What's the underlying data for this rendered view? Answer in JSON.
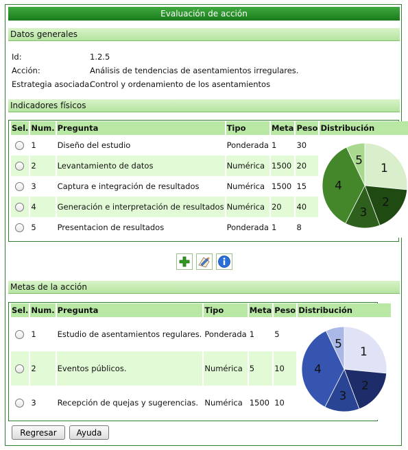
{
  "window": {
    "title": "Evaluación de acción"
  },
  "datos_generales": {
    "header": "Datos generales",
    "fields": [
      {
        "label": "Id:",
        "value": "1.2.5"
      },
      {
        "label": "Acción:",
        "value": "Análisis de tendencias de asentamientos irregulares."
      },
      {
        "label": "Estrategia asociada:",
        "value": "Control y ordenamiento de los asentamientos"
      }
    ]
  },
  "indicadores": {
    "header": "Indicadores físicos",
    "columns": [
      "Sel.",
      "Num.",
      "Pregunta",
      "Tipo",
      "Meta",
      "Peso",
      "Distribución"
    ],
    "rows": [
      {
        "num": "1",
        "pregunta": "Diseño del estudio",
        "tipo": "Ponderada",
        "meta": "1",
        "peso": "30"
      },
      {
        "num": "2",
        "pregunta": "Levantamiento de datos",
        "tipo": "Numérica",
        "meta": "1500",
        "peso": "20"
      },
      {
        "num": "3",
        "pregunta": "Captura e integración de resultados",
        "tipo": "Numérica",
        "meta": "1500",
        "peso": "15"
      },
      {
        "num": "4",
        "pregunta": "Generación e interpretación de resultados",
        "tipo": "Numérica",
        "meta": "20",
        "peso": "40"
      },
      {
        "num": "5",
        "pregunta": "Presentacion de resultados",
        "tipo": "Ponderada",
        "meta": "1",
        "peso": "8"
      }
    ],
    "pie": {
      "labels": [
        "1",
        "2",
        "3",
        "4",
        "5"
      ],
      "values": [
        30,
        20,
        15,
        40,
        8
      ],
      "colors": [
        "#d9efcc",
        "#1f4a12",
        "#2f5f1c",
        "#44862a",
        "#a9d98e"
      ]
    }
  },
  "toolbar": {
    "add_icon": "plus-icon",
    "edit_icon": "edit-icon",
    "info_icon": "info-icon",
    "colors": {
      "add": "#2e9a1e",
      "info": "#2a6fd8"
    }
  },
  "metas": {
    "header": "Metas de la acción",
    "columns": [
      "Sel.",
      "Num.",
      "Pregunta",
      "Tipo",
      "Meta",
      "Peso",
      "Distribución"
    ],
    "rows": [
      {
        "num": "1",
        "pregunta": "Estudio de asentamientos regulares.",
        "tipo": "Ponderada",
        "meta": "1",
        "peso": "5"
      },
      {
        "num": "2",
        "pregunta": "Eventos públicos.",
        "tipo": "Numérica",
        "meta": "5",
        "peso": "10"
      },
      {
        "num": "3",
        "pregunta": "Recepción de quejas y sugerencias.",
        "tipo": "Numérica",
        "meta": "1500",
        "peso": "10"
      }
    ],
    "pie": {
      "labels": [
        "1",
        "2",
        "3",
        "4",
        "5"
      ],
      "values": [
        30,
        20,
        15,
        40,
        8
      ],
      "colors": [
        "#dfe3f5",
        "#1d2d6a",
        "#2a4494",
        "#3555b0",
        "#a9b8e6"
      ]
    }
  },
  "buttons": {
    "regresar": "Regresar",
    "ayuda": "Ayuda"
  }
}
